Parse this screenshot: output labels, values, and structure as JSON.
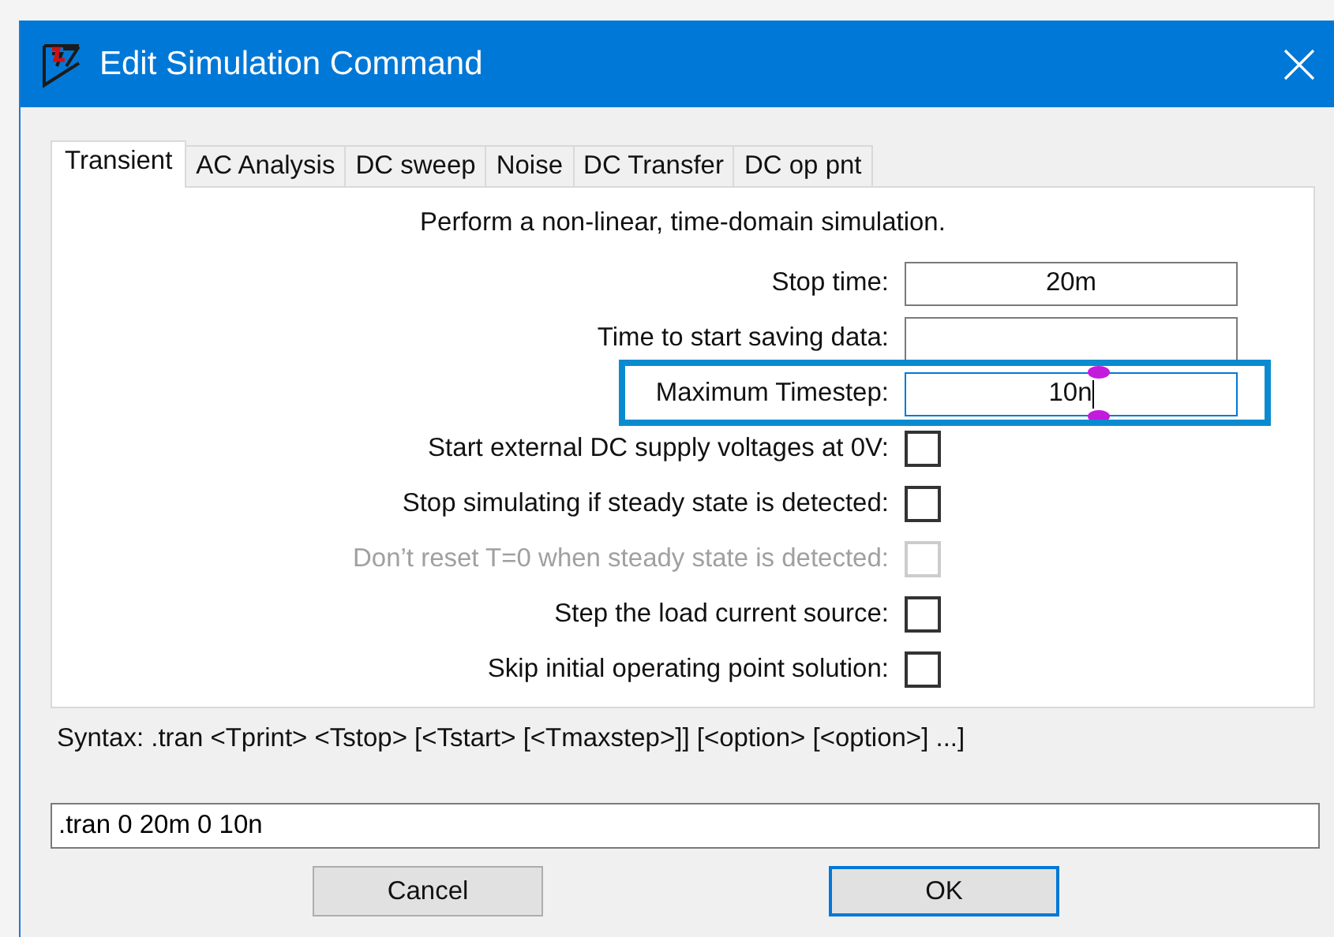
{
  "window": {
    "title": "Edit Simulation Command"
  },
  "tabs": [
    {
      "label": "Transient",
      "selected": true
    },
    {
      "label": "AC Analysis",
      "selected": false
    },
    {
      "label": "DC sweep",
      "selected": false
    },
    {
      "label": "Noise",
      "selected": false
    },
    {
      "label": "DC Transfer",
      "selected": false
    },
    {
      "label": "DC op pnt",
      "selected": false
    }
  ],
  "description": "Perform a non-linear, time-domain simulation.",
  "rows": [
    {
      "kind": "text",
      "label": "Stop time:",
      "value": "20m",
      "focused": false,
      "highlighted": false
    },
    {
      "kind": "text",
      "label": "Time to start saving data:",
      "value": "",
      "focused": false,
      "highlighted": false
    },
    {
      "kind": "text",
      "label": "Maximum Timestep:",
      "value": "10n",
      "focused": true,
      "highlighted": true
    },
    {
      "kind": "checkbox",
      "label": "Start external DC supply voltages at 0V:",
      "checked": false,
      "disabled": false
    },
    {
      "kind": "checkbox",
      "label": "Stop simulating if steady state is detected:",
      "checked": false,
      "disabled": false
    },
    {
      "kind": "checkbox",
      "label": "Don’t reset T=0 when steady state is detected:",
      "checked": false,
      "disabled": true
    },
    {
      "kind": "checkbox",
      "label": "Step the load current source:",
      "checked": false,
      "disabled": false
    },
    {
      "kind": "checkbox",
      "label": "Skip initial operating point solution:",
      "checked": false,
      "disabled": false
    }
  ],
  "syntax": "Syntax:  .tran <Tprint> <Tstop> [<Tstart> [<Tmaxstep>]] [<option> [<option>] ...]",
  "command": {
    "value": ".tran 0 20m 0 10n"
  },
  "buttons": [
    {
      "label": "Cancel",
      "default": false
    },
    {
      "label": "OK",
      "default": true
    }
  ]
}
